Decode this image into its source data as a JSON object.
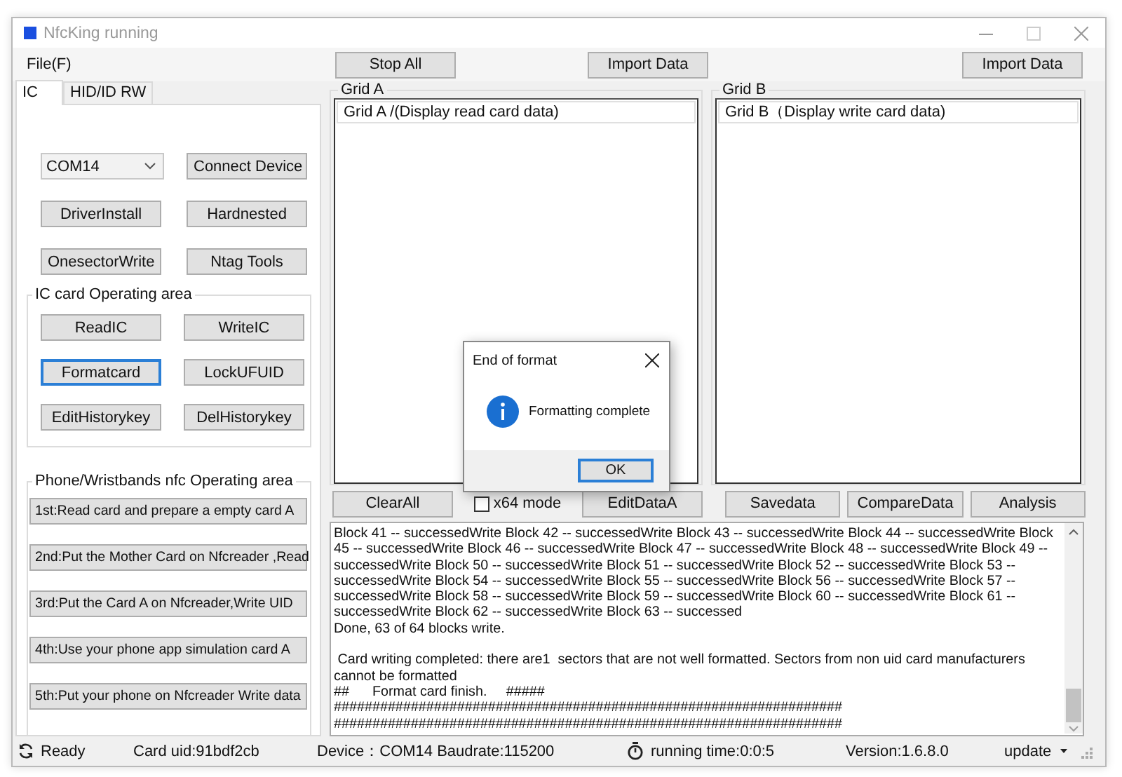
{
  "window": {
    "title": "NfcKing running",
    "active": false
  },
  "menu": [
    {
      "label": "File(F)"
    }
  ],
  "toolbar": {
    "grid_a": [
      "Stop All",
      "Import Data"
    ],
    "grid_b": [
      "Import Data"
    ]
  },
  "tabs": [
    {
      "label": "IC",
      "selected": true
    },
    {
      "label": "HID/ID RW",
      "selected": false
    }
  ],
  "device": {
    "port": "COM14",
    "buttons": [
      "Connect Device",
      "DriverInstall",
      "Hardnested",
      "OnesectorWrite",
      "Ntag Tools"
    ]
  },
  "ic_group": {
    "title": "IC card Operating area",
    "buttons": [
      {
        "label": "ReadIC",
        "focused": false
      },
      {
        "label": "WriteIC",
        "focused": false
      },
      {
        "label": "Formatcard",
        "focused": true
      },
      {
        "label": "LockUFUID",
        "focused": false
      },
      {
        "label": "EditHistorykey",
        "focused": false
      },
      {
        "label": "DelHistorykey",
        "focused": false
      }
    ]
  },
  "phone_group": {
    "title": "Phone/Wristbands nfc Operating area",
    "buttons": [
      "1st:Read card and prepare a empty card A",
      "2nd:Put the Mother Card on Nfcreader ,Read",
      "3rd:Put the Card A on Nfcreader,Write UID",
      "4th:Use your phone app simulation card A",
      "5th:Put your phone on Nfcreader Write data"
    ]
  },
  "grid_a": {
    "title": "Grid A",
    "header": "Grid A /(Display read card data)",
    "actions": [
      {
        "kind": "button",
        "label": "ClearAll"
      },
      {
        "kind": "checkbox",
        "label": "x64 mode",
        "checked": false
      },
      {
        "kind": "button",
        "label": "EditDataA"
      }
    ]
  },
  "grid_b": {
    "title": "Grid B",
    "header": "Grid B（Display write card data)",
    "actions": [
      {
        "kind": "button",
        "label": "Savedata"
      },
      {
        "kind": "button",
        "label": "CompareData"
      },
      {
        "kind": "button",
        "label": "Analysis"
      }
    ]
  },
  "log": {
    "lines": [
      {
        "text": "Block 41 -- successedWrite Block 42 -- successedWrite Block 43 -- successedWrite Block 44 -- successedWrite Block 45 -- successedWrite Block 46 -- successedWrite Block 47 -- successedWrite Block 48 -- successedWrite Block 49 -- successedWrite Block 50 -- successedWrite Block 51 -- successedWrite Block 52 -- successedWrite Block 53 -- successedWrite Block 54 -- successedWrite Block 55 -- successedWrite Block 56 -- successedWrite Block 57 -- successedWrite Block 58 -- successedWrite Block 59 -- successedWrite Block 60 -- successedWrite Block 61 -- successedWrite Block 62 -- successedWrite Block 63 -- successed",
        "gap_before": false
      },
      {
        "text": "Done, 63 of 64 blocks write.",
        "gap_before": false
      },
      {
        "text": " Card writing completed: there are1  sectors that are not well formatted. Sectors from non uid card manufacturers cannot be formatted",
        "gap_before": true
      },
      {
        "text": "##      Format card finish.     #####",
        "gap_before": false
      },
      {
        "text": "##################################################################",
        "gap_before": false
      },
      {
        "text": "##################################################################",
        "gap_before": false
      }
    ]
  },
  "status_bar": [
    {
      "kind": "ready",
      "text": "Ready"
    },
    {
      "kind": "text",
      "text": "Card uid:91bdf2cb"
    },
    {
      "kind": "text",
      "text": "Device：COM14 Baudrate:115200"
    },
    {
      "kind": "timer",
      "text": "running time:0:0:5"
    },
    {
      "kind": "text",
      "text": "Version:1.6.8.0"
    },
    {
      "kind": "dropdown",
      "text": "update"
    }
  ],
  "dialog": {
    "title": "End of format",
    "message": "Formatting complete",
    "button": {
      "label": "OK",
      "focused": true
    }
  }
}
